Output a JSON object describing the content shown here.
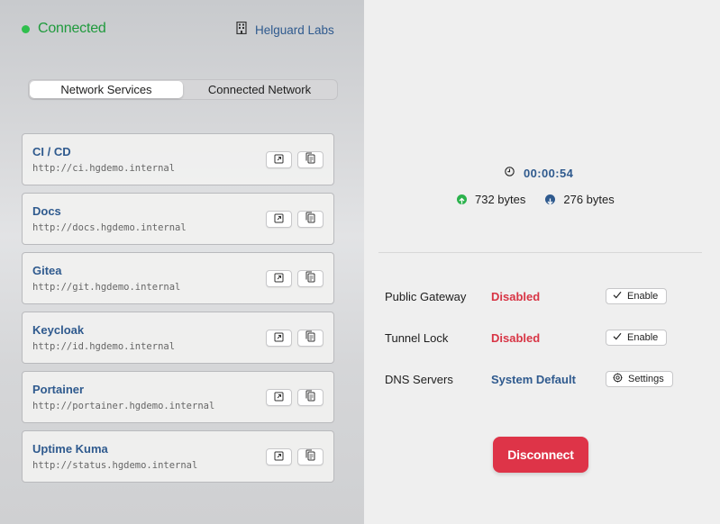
{
  "status": {
    "label": "Connected",
    "color": "#2fbf4d"
  },
  "organization": {
    "name": "Helguard Labs",
    "icon": "building-icon"
  },
  "tabs": [
    {
      "label": "Network Services",
      "active": true
    },
    {
      "label": "Connected Network",
      "active": false
    }
  ],
  "services": [
    {
      "name": "CI / CD",
      "url": "http://ci.hgdemo.internal"
    },
    {
      "name": "Docs",
      "url": "http://docs.hgdemo.internal"
    },
    {
      "name": "Gitea",
      "url": "http://git.hgdemo.internal"
    },
    {
      "name": "Keycloak",
      "url": "http://id.hgdemo.internal"
    },
    {
      "name": "Portainer",
      "url": "http://portainer.hgdemo.internal"
    },
    {
      "name": "Uptime Kuma",
      "url": "http://status.hgdemo.internal"
    }
  ],
  "session": {
    "duration": "00:00:54",
    "upload": "732 bytes",
    "download": "276 bytes"
  },
  "settings": [
    {
      "label": "Public Gateway",
      "value": "Disabled",
      "status": "bad",
      "action": "Enable",
      "action_icon": "check-icon"
    },
    {
      "label": "Tunnel Lock",
      "value": "Disabled",
      "status": "bad",
      "action": "Enable",
      "action_icon": "check-icon"
    },
    {
      "label": "DNS Servers",
      "value": "System Default",
      "status": "info",
      "action": "Settings",
      "action_icon": "gear-icon"
    }
  ],
  "disconnect_label": "Disconnect",
  "colors": {
    "accent": "#2f5a8e",
    "danger": "#de3448",
    "success": "#2fbf4d"
  }
}
